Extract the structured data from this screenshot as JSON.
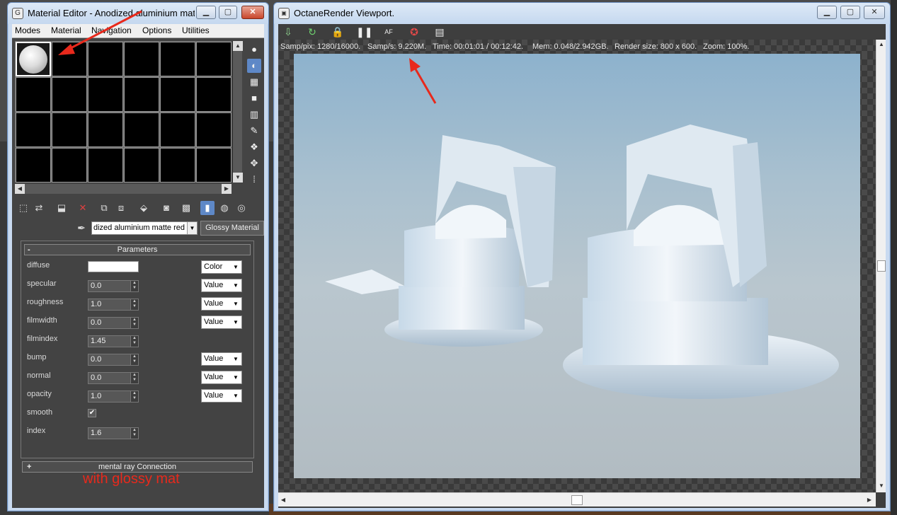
{
  "material_editor": {
    "title": "Material Editor - Anodized aluminium mat...",
    "controls": {
      "minimize": "▁",
      "maximize": "▢",
      "close": "✕"
    },
    "menu": [
      "Modes",
      "Material",
      "Navigation",
      "Options",
      "Utilities"
    ],
    "material_name": "dized aluminium matte red",
    "material_type": "Glossy Material",
    "parameters_title": "Parameters",
    "rollout_sign_open": "-",
    "rollout_sign_closed": "+",
    "params": [
      {
        "label": "diffuse",
        "kind": "color",
        "mode": "Color"
      },
      {
        "label": "specular",
        "kind": "spinner",
        "value": "0.0",
        "mode": "Value"
      },
      {
        "label": "roughness",
        "kind": "spinner",
        "value": "1.0",
        "mode": "Value"
      },
      {
        "label": "filmwidth",
        "kind": "spinner",
        "value": "0.0",
        "mode": "Value"
      },
      {
        "label": "filmindex",
        "kind": "spinner",
        "value": "1.45"
      },
      {
        "label": "bump",
        "kind": "spinner",
        "value": "0.0",
        "mode": "Value"
      },
      {
        "label": "normal",
        "kind": "spinner",
        "value": "0.0",
        "mode": "Value"
      },
      {
        "label": "opacity",
        "kind": "spinner",
        "value": "1.0",
        "mode": "Value"
      },
      {
        "label": "smooth",
        "kind": "checkbox",
        "checked": true
      },
      {
        "label": "index",
        "kind": "spinner",
        "value": "1.6"
      }
    ],
    "mental_ray_title": "mental ray Connection",
    "annotation": "with glossy mat"
  },
  "viewport": {
    "title": "OctaneRender Viewport.",
    "controls": {
      "minimize": "▁",
      "maximize": "▢",
      "close": "✕"
    },
    "status": {
      "samp_pix": "Samp/pix: 1280/16000.",
      "samp_s": "Samp/s: 9.220M.",
      "time": "Time: 00:01:01 / 00:12:42.",
      "mem": "Mem: 0.048/2.942GB.",
      "render_size": "Render size: 800 x 600.",
      "zoom": "Zoom: 100%."
    }
  },
  "colors": {
    "annotation_red": "#e8291c",
    "active_tool": "#5e88c7"
  }
}
